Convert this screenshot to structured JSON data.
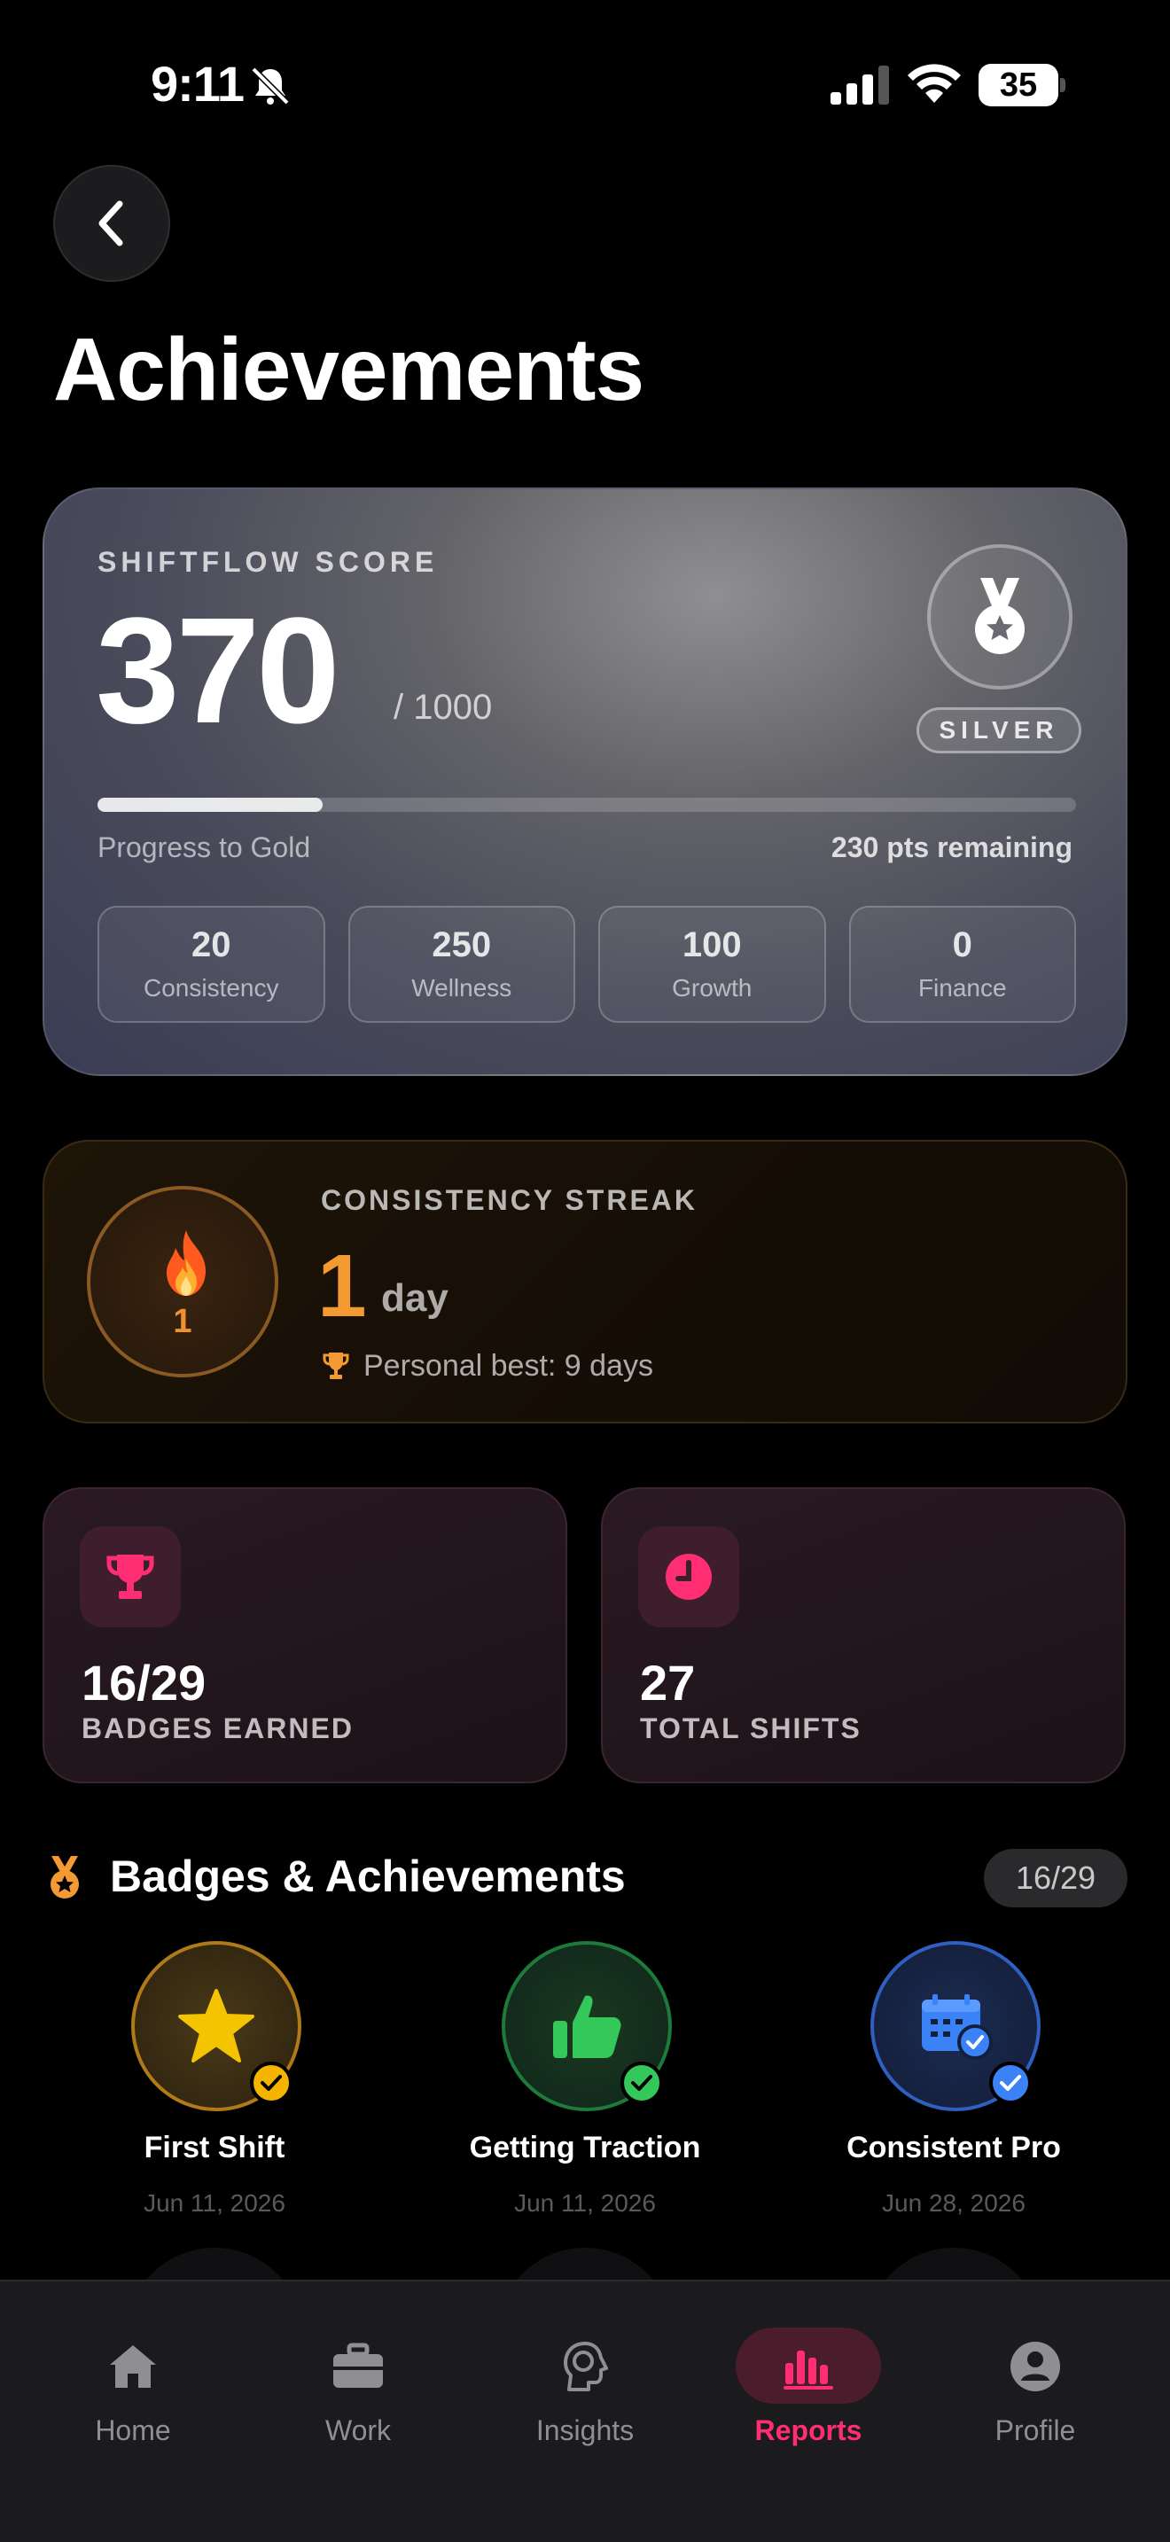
{
  "status_bar": {
    "time": "9:11",
    "battery": "35"
  },
  "page": {
    "title": "Achievements"
  },
  "score_card": {
    "label": "SHIFTFLOW SCORE",
    "score": "370",
    "max": "/ 1000",
    "tier": "SILVER",
    "progress_fraction": 0.23,
    "progress_label": "Progress to Gold",
    "remaining": "230 pts remaining",
    "categories": [
      {
        "value": "20",
        "name": "Consistency"
      },
      {
        "value": "250",
        "name": "Wellness"
      },
      {
        "value": "100",
        "name": "Growth"
      },
      {
        "value": "0",
        "name": "Finance"
      }
    ]
  },
  "streak": {
    "ring_number": "1",
    "label": "CONSISTENCY STREAK",
    "value": "1",
    "unit": "day",
    "best": "Personal best: 9 days"
  },
  "stats": [
    {
      "value": "16/29",
      "label": "BADGES EARNED",
      "icon": "trophy-icon"
    },
    {
      "value": "27",
      "label": "TOTAL SHIFTS",
      "icon": "clock-icon"
    }
  ],
  "badges": {
    "title": "Badges & Achievements",
    "count": "16/29",
    "items": [
      {
        "name": "First Shift",
        "date": "Jun 11, 2026",
        "icon": "star-icon",
        "color": "#f5b400"
      },
      {
        "name": "Getting Traction",
        "date": "Jun 11, 2026",
        "icon": "thumbs-up-icon",
        "color": "#34c759"
      },
      {
        "name": "Consistent Pro",
        "date": "Jun 28, 2026",
        "icon": "calendar-check-icon",
        "color": "#3b82f6"
      }
    ]
  },
  "tabs": [
    {
      "label": "Home",
      "icon": "home-icon"
    },
    {
      "label": "Work",
      "icon": "briefcase-icon"
    },
    {
      "label": "Insights",
      "icon": "brain-icon"
    },
    {
      "label": "Reports",
      "icon": "bar-chart-icon",
      "active": true
    },
    {
      "label": "Profile",
      "icon": "person-icon"
    }
  ],
  "colors": {
    "accent": "#ff2d72",
    "streak": "#f39a32"
  }
}
